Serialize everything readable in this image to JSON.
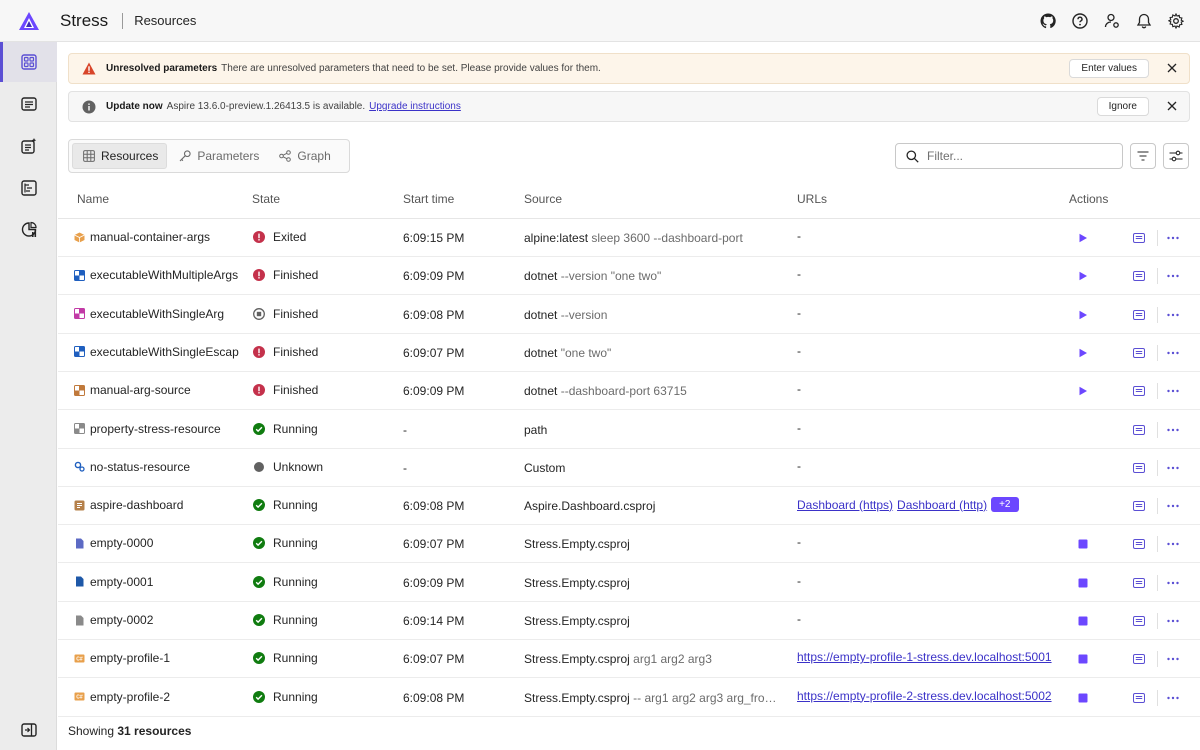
{
  "header": {
    "app_title": "Stress",
    "subtitle": "Resources",
    "icons": [
      "github-icon",
      "help-icon",
      "user-settings-icon",
      "bell-icon",
      "gear-icon"
    ]
  },
  "sidebar": {
    "items": [
      "resources",
      "console-logs",
      "structured-logs",
      "traces",
      "metrics"
    ],
    "bottom": "expand-panel"
  },
  "banners": {
    "warning": {
      "title": "Unresolved parameters",
      "text": "There are unresolved parameters that need to be set. Please provide values for them.",
      "button": "Enter values"
    },
    "update": {
      "title": "Update now",
      "text": "Aspire 13.6.0-preview.1.26413.5 is available.",
      "link": "Upgrade instructions",
      "button": "Ignore"
    }
  },
  "tabs": [
    {
      "label": "Resources",
      "icon": "grid-icon"
    },
    {
      "label": "Parameters",
      "icon": "key-icon"
    },
    {
      "label": "Graph",
      "icon": "graph-icon"
    }
  ],
  "filter": {
    "placeholder": "Filter..."
  },
  "columns": {
    "name": "Name",
    "state": "State",
    "start": "Start time",
    "source": "Source",
    "urls": "URLs",
    "actions": "Actions"
  },
  "rows": [
    {
      "name": "manual-container-args",
      "icon": "container",
      "state": "Exited",
      "status": "error",
      "start": "6:09:15 PM",
      "source": "alpine:latest",
      "args": " sleep 3600 --dashboard-port",
      "urls": [
        "-"
      ],
      "action": "play"
    },
    {
      "name": "executableWithMultipleArgs",
      "icon": "exe-blue",
      "state": "Finished",
      "status": "error",
      "start": "6:09:09 PM",
      "source": "dotnet",
      "args": " --version \"one two\"",
      "urls": [
        "-"
      ],
      "action": "play"
    },
    {
      "name": "executableWithSingleArg",
      "icon": "exe-pink",
      "state": "Finished",
      "status": "neutral",
      "start": "6:09:08 PM",
      "source": "dotnet",
      "args": " --version",
      "urls": [
        "-"
      ],
      "action": "play"
    },
    {
      "name": "executableWithSingleEscap",
      "icon": "exe-blue",
      "state": "Finished",
      "status": "error",
      "start": "6:09:07 PM",
      "source": "dotnet",
      "args": " \"one two\"",
      "urls": [
        "-"
      ],
      "action": "play"
    },
    {
      "name": "manual-arg-source",
      "icon": "exe-orange",
      "state": "Finished",
      "status": "error",
      "start": "6:09:09 PM",
      "source": "dotnet",
      "args": " --dashboard-port 63715",
      "urls": [
        "-"
      ],
      "action": "play"
    },
    {
      "name": "property-stress-resource",
      "icon": "exe-gray",
      "state": "Running",
      "status": "ok",
      "start": "-",
      "source": "path",
      "args": "",
      "urls": [
        "-"
      ],
      "action": ""
    },
    {
      "name": "no-status-resource",
      "icon": "gears",
      "state": "Unknown",
      "status": "unknown",
      "start": "-",
      "source": "Custom",
      "args": "",
      "urls": [
        "-"
      ],
      "action": ""
    },
    {
      "name": "aspire-dashboard",
      "icon": "project-brown",
      "state": "Running",
      "status": "ok",
      "start": "6:09:08 PM",
      "source": "Aspire.Dashboard.csproj",
      "args": "",
      "urls": [
        "Dashboard (https)",
        "Dashboard (http)"
      ],
      "badge": "+2",
      "action": ""
    },
    {
      "name": "empty-0000",
      "icon": "doc-purple",
      "state": "Running",
      "status": "ok",
      "start": "6:09:07 PM",
      "source": "Stress.Empty.csproj",
      "args": "",
      "urls": [
        "-"
      ],
      "action": "stop"
    },
    {
      "name": "empty-0001",
      "icon": "doc-blue",
      "state": "Running",
      "status": "ok",
      "start": "6:09:09 PM",
      "source": "Stress.Empty.csproj",
      "args": "",
      "urls": [
        "-"
      ],
      "action": "stop"
    },
    {
      "name": "empty-0002",
      "icon": "doc-gray",
      "state": "Running",
      "status": "ok",
      "start": "6:09:14 PM",
      "source": "Stress.Empty.csproj",
      "args": "",
      "urls": [
        "-"
      ],
      "action": "stop"
    },
    {
      "name": "empty-profile-1",
      "icon": "cs-orange",
      "state": "Running",
      "status": "ok",
      "start": "6:09:07 PM",
      "source": "Stress.Empty.csproj",
      "args": " arg1 arg2 arg3",
      "urls": [
        "https://empty-profile-1-stress.dev.localhost:5001"
      ],
      "action": "stop"
    },
    {
      "name": "empty-profile-2",
      "icon": "cs-orange",
      "state": "Running",
      "status": "ok",
      "start": "6:09:08 PM",
      "source": "Stress.Empty.csproj",
      "args": " -- arg1 arg2 arg3 arg_fro…",
      "urls": [
        "https://empty-profile-2-stress.dev.localhost:5002"
      ],
      "action": "stop"
    }
  ],
  "footer": {
    "prefix": "Showing ",
    "count": "31 resources"
  },
  "colors": {
    "accent": "#6c47ff",
    "error": "#c4314b",
    "ok": "#107c10",
    "link": "#3b32c8"
  }
}
